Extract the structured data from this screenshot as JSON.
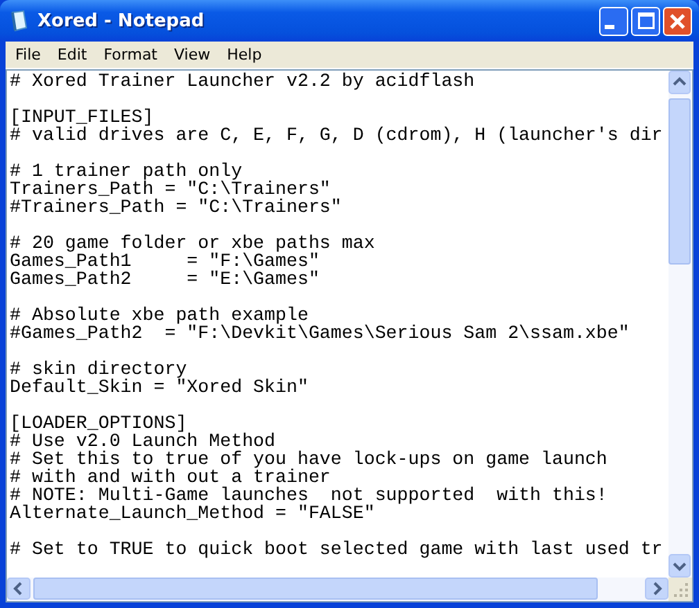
{
  "window": {
    "title": "Xored - Notepad"
  },
  "menu": [
    "File",
    "Edit",
    "Format",
    "View",
    "Help"
  ],
  "editor": {
    "paragraphs": [
      [
        "# Xored Trainer Launcher v2.2 by acidflash"
      ],
      [
        "[INPUT_FILES]",
        "# valid drives are C, E, F, G, D (cdrom), H (launcher's dir"
      ],
      [
        "# 1 trainer path only",
        "Trainers_Path = \"C:\\Trainers\"",
        "#Trainers_Path = \"C:\\Trainers\""
      ],
      [
        "# 20 game folder or xbe paths max",
        "Games_Path1     = \"F:\\Games\"",
        "Games_Path2     = \"E:\\Games\""
      ],
      [
        "# Absolute xbe path example",
        "#Games_Path2  = \"F:\\Devkit\\Games\\Serious Sam 2\\ssam.xbe\""
      ],
      [
        "# skin directory",
        "Default_Skin = \"Xored Skin\""
      ],
      [
        "[LOADER_OPTIONS]",
        "# Use v2.0 Launch Method",
        "# Set this to true of you have lock-ups on game launch",
        "# with and with out a trainer",
        "# NOTE: Multi-Game launches  not supported  with this!",
        "Alternate_Launch_Method = \"FALSE\""
      ],
      [
        "# Set to TRUE to quick boot selected game with last used tr"
      ]
    ]
  }
}
